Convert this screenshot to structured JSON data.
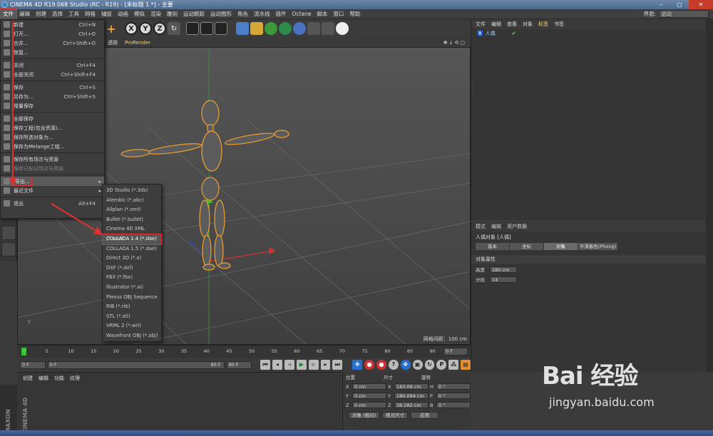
{
  "window": {
    "title": "CINEMA 4D R19.068 Studio (RC - R19) - [未标题 1 *] - 主要",
    "min": "–",
    "max": "▢",
    "close": "✕"
  },
  "menubar": {
    "items": [
      "文件",
      "编辑",
      "创建",
      "选择",
      "工具",
      "网格",
      "捕捉",
      "动画",
      "模拟",
      "渲染",
      "雕刻",
      "运动跟踪",
      "运动图形",
      "角色",
      "流水线",
      "插件",
      "Octane",
      "脚本",
      "窗口",
      "帮助"
    ],
    "layout_label": "界面:",
    "layout_value": "启动"
  },
  "file_menu": [
    {
      "label": "新建",
      "shortcut": "Ctrl+N"
    },
    {
      "label": "打开...",
      "shortcut": "Ctrl+O"
    },
    {
      "label": "合并...",
      "shortcut": "Ctrl+Shift+O"
    },
    {
      "label": "恢复...",
      "shortcut": ""
    },
    {
      "label": "关闭",
      "shortcut": "Ctrl+F4"
    },
    {
      "label": "全部关闭",
      "shortcut": "Ctrl+Shift+F4"
    },
    {
      "label": "保存",
      "shortcut": "Ctrl+S"
    },
    {
      "label": "另存为...",
      "shortcut": "Ctrl+Shift+S"
    },
    {
      "label": "增量保存",
      "shortcut": ""
    },
    {
      "label": "全部保存",
      "shortcut": ""
    },
    {
      "label": "保存工程(包含资源)...",
      "shortcut": ""
    },
    {
      "label": "保存所选对象为...",
      "shortcut": ""
    },
    {
      "label": "保存为Melange工程...",
      "shortcut": ""
    },
    {
      "label": "保存所有场次与资源",
      "shortcut": ""
    },
    {
      "label": "保存已标记场次与资源",
      "shortcut": ""
    },
    {
      "label": "导出...",
      "shortcut": ""
    },
    {
      "label": "最近文件",
      "shortcut": ""
    },
    {
      "label": "退出",
      "shortcut": "Alt+F4"
    }
  ],
  "export_submenu": [
    "3D Studio (*.3ds)",
    "Alembic (*.abc)",
    "Allplan (*.xml)",
    "Bullet (*.bullet)",
    "Cinema 4D XML (*.xml)",
    "COLLADA 1.4 (*.dae)",
    "COLLADA 1.5 (*.dae)",
    "Direct 3D (*.x)",
    "DXF (*.dxf)",
    "FBX (*.fbx)",
    "Illustrator (*.ai)",
    "Plexus OBJ Sequence",
    "RIB (*.rib)",
    "STL (*.stl)",
    "VRML 2 (*.wrl)",
    "Wavefront OBJ (*.obj)"
  ],
  "viewport": {
    "tabs": [
      "透视",
      "ProRender"
    ],
    "grid_info": "网格间距：100 cm"
  },
  "object_manager": {
    "tabs": [
      "文件",
      "编辑",
      "查看",
      "对象",
      "标签",
      "书签"
    ],
    "object_name": "人偶"
  },
  "attributes": {
    "tabs": [
      "模式",
      "编辑",
      "用户数据"
    ],
    "title": "人偶对象 [人偶]",
    "sub_tabs": [
      "基本",
      "坐标",
      "对象",
      "平滑着色(Phong)"
    ],
    "section": "对象属性",
    "fields": [
      {
        "label": "高度",
        "value": "180 cm"
      },
      {
        "label": "分段",
        "value": "14"
      }
    ]
  },
  "timeline": {
    "ticks": [
      "0",
      "5",
      "10",
      "15",
      "20",
      "25",
      "30",
      "35",
      "40",
      "45",
      "50",
      "55",
      "60",
      "65",
      "70",
      "75",
      "80",
      "85",
      "90"
    ],
    "current": "0 F"
  },
  "transport": {
    "start": "0 F",
    "range_start": "0 F",
    "range_end": "90 F",
    "end": "90 F"
  },
  "material": {
    "tabs": [
      "创建",
      "编辑",
      "功能",
      "纹理"
    ]
  },
  "coordinates": {
    "headers": [
      "位置",
      "尺寸",
      "旋转"
    ],
    "rows": [
      {
        "axis": "X",
        "pos": "0 cm",
        "size": "183.06 cm",
        "rot_label": "H",
        "rot": "0 °"
      },
      {
        "axis": "Y",
        "pos": "0 cm",
        "size": "180.094 cm",
        "rot_label": "P",
        "rot": "0 °"
      },
      {
        "axis": "Z",
        "pos": "0 cm",
        "size": "36.282 cm",
        "rot_label": "B",
        "rot": "0 °"
      }
    ],
    "mode1": "对象 (相对)",
    "mode2": "绝对尺寸",
    "apply": "应用"
  },
  "watermark": {
    "brand": "Bai 经验",
    "url": "jingyan.baidu.com"
  },
  "maxon": "MAXON CINEMA 4D"
}
